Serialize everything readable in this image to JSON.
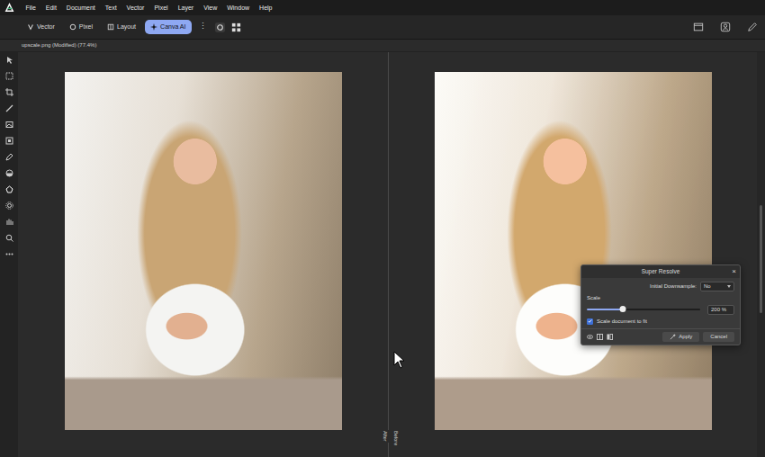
{
  "menu": [
    "File",
    "Edit",
    "Document",
    "Text",
    "Vector",
    "Pixel",
    "Layer",
    "View",
    "Window",
    "Help"
  ],
  "toolbar": {
    "personas": [
      {
        "label": "Vector",
        "selected": false
      },
      {
        "label": "Pixel",
        "selected": false
      },
      {
        "label": "Layout",
        "selected": false
      },
      {
        "label": "Canva AI",
        "selected": true
      }
    ],
    "more": "⋮"
  },
  "document": {
    "tab": "upscale.png (Modified) (77.4%)"
  },
  "split_view": {
    "labels": [
      "After",
      "Before"
    ]
  },
  "dialog": {
    "title": "Super Resolve",
    "close": "×",
    "downsample": {
      "label": "Initial Downsample:",
      "value": "No"
    },
    "scale": {
      "label": "Scale",
      "level": 0.32,
      "reading": "200 %"
    },
    "fit": {
      "label": "Scale document to fit",
      "checked": true
    },
    "apply": "Apply",
    "cancel": "Cancel"
  }
}
